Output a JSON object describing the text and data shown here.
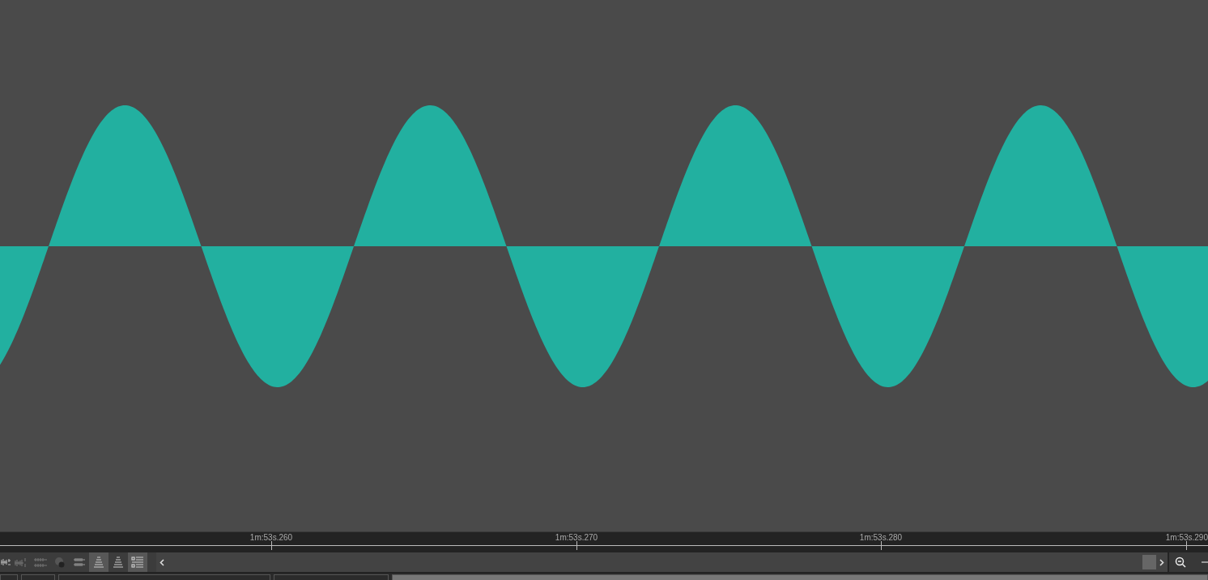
{
  "ruler": {
    "labels": [
      "1m:53s.260",
      "1m:53s.270",
      "1m:53s.280",
      "1m:53s.290"
    ]
  },
  "toolbar": {
    "buttons": [
      {
        "kind": "waveform-plus",
        "selected": false
      },
      {
        "kind": "waveform-lr",
        "selected": false
      },
      {
        "kind": "waveform-stack",
        "selected": false
      },
      {
        "kind": "record",
        "selected": false
      },
      {
        "kind": "waveform-dense",
        "selected": false
      },
      {
        "kind": "levels",
        "selected": true
      },
      {
        "kind": "levels",
        "selected": false
      },
      {
        "kind": "list",
        "selected": true
      }
    ]
  }
}
